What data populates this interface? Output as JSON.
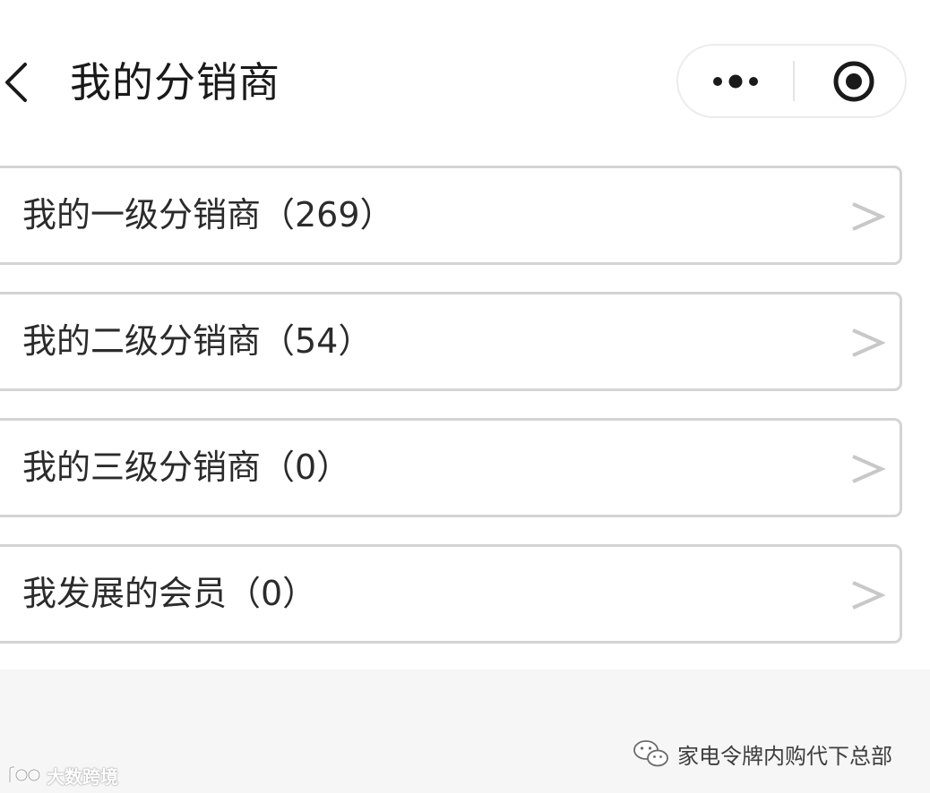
{
  "header": {
    "title": "我的分销商",
    "back_icon": "chevron-left-icon",
    "more_icon": "more-dots-icon",
    "close_icon": "target-close-icon"
  },
  "list": {
    "items": [
      {
        "label": "我的一级分销商（269）"
      },
      {
        "label": "我的二级分销商（54）"
      },
      {
        "label": "我的三级分销商（0）"
      },
      {
        "label": "我发展的会员（0）"
      }
    ],
    "chevron_glyph": ">"
  },
  "watermarks": {
    "left_text": "大数跨境",
    "right_text": "家电令牌内购代下总部"
  },
  "colors": {
    "border": "#d4d4d4",
    "chevron": "#c8c8c8",
    "text": "#2b2b2b",
    "bottom_bg": "#f6f6f6"
  }
}
